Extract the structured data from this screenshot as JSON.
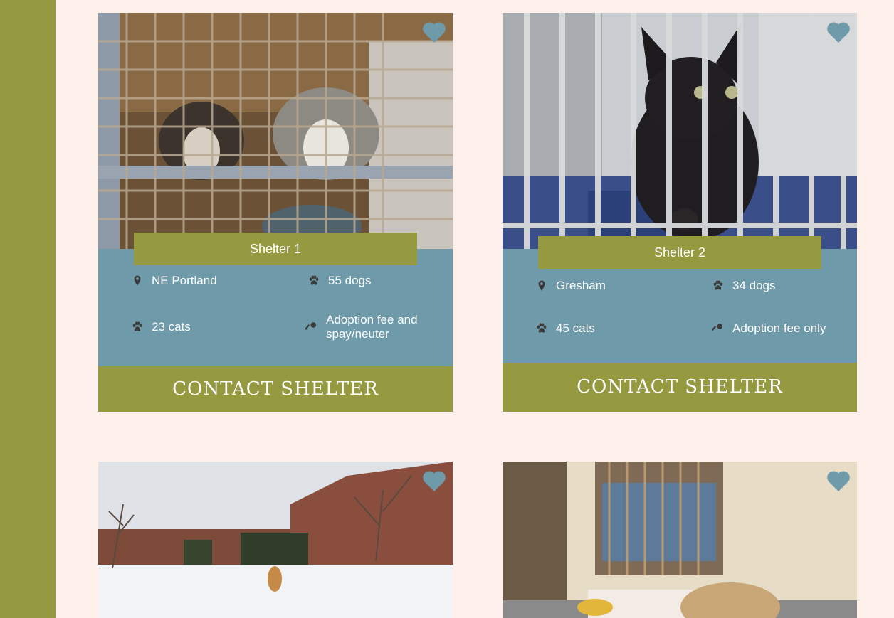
{
  "shelters": [
    {
      "name": "Shelter 1",
      "location": "NE Portland",
      "dogs": "55 dogs",
      "cats": "23 cats",
      "fee_line1": "Adoption fee and",
      "fee_line2": "spay/neuter",
      "contact_label": "CONTACT SHELTER",
      "photo_icon": "dogs-in-cage-photo"
    },
    {
      "name": "Shelter 2",
      "location": "Gresham",
      "dogs": "34 dogs",
      "cats": "45 cats",
      "fee": "Adoption fee only",
      "contact_label": "CONTACT SHELTER",
      "photo_icon": "kitten-in-cage-photo"
    },
    {
      "photo_icon": "dog-in-snowy-yard-photo"
    },
    {
      "photo_icon": "puppy-in-kennel-photo"
    }
  ],
  "icons": {
    "heart": "heart-icon",
    "location": "map-pin-icon",
    "paw": "paw-icon",
    "key": "key-icon"
  },
  "colors": {
    "background": "#fdf0ea",
    "sidebar": "#959a40",
    "accent": "#959a40",
    "info_panel": "#6f9aaa",
    "heart": "#6f9aaa"
  }
}
